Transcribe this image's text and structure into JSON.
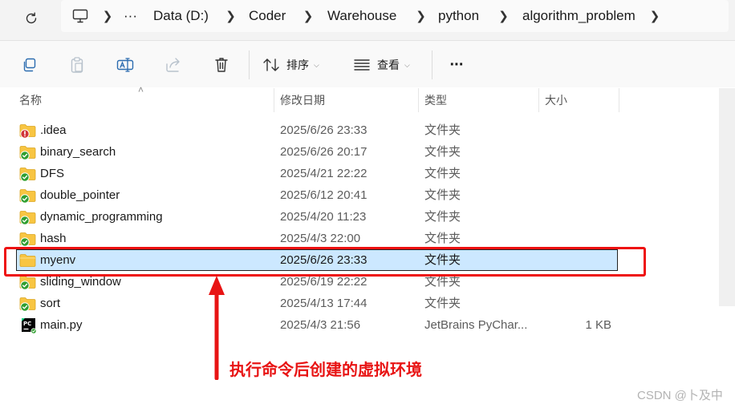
{
  "address_bar": {
    "breadcrumbs": [
      "Data (D:)",
      "Coder",
      "Warehouse",
      "python",
      "algorithm_problem"
    ],
    "more_label": "···",
    "icons": [
      "refresh-icon",
      "monitor-icon",
      "chevron-right-icon"
    ]
  },
  "toolbar": {
    "sort_label": "排序",
    "view_label": "查看",
    "more_label": "···",
    "icons": [
      "copy-icon",
      "paste-icon",
      "rename-icon",
      "share-icon",
      "delete-icon",
      "sort-icon",
      "view-icon"
    ]
  },
  "columns": {
    "name": "名称",
    "modified": "修改日期",
    "type": "类型",
    "size": "大小"
  },
  "files": [
    {
      "name": ".idea",
      "modified": "2025/6/26 23:33",
      "type": "文件夹",
      "size": "",
      "icon": "folder-warning-icon",
      "selected": false
    },
    {
      "name": "binary_search",
      "modified": "2025/6/26 20:17",
      "type": "文件夹",
      "size": "",
      "icon": "folder-synced-icon",
      "selected": false
    },
    {
      "name": "DFS",
      "modified": "2025/4/21 22:22",
      "type": "文件夹",
      "size": "",
      "icon": "folder-synced-icon",
      "selected": false
    },
    {
      "name": "double_pointer",
      "modified": "2025/6/12 20:41",
      "type": "文件夹",
      "size": "",
      "icon": "folder-synced-icon",
      "selected": false
    },
    {
      "name": "dynamic_programming",
      "modified": "2025/4/20 11:23",
      "type": "文件夹",
      "size": "",
      "icon": "folder-synced-icon",
      "selected": false
    },
    {
      "name": "hash",
      "modified": "2025/4/3 22:00",
      "type": "文件夹",
      "size": "",
      "icon": "folder-synced-icon",
      "selected": false
    },
    {
      "name": "myenv",
      "modified": "2025/6/26 23:33",
      "type": "文件夹",
      "size": "",
      "icon": "folder-icon",
      "selected": true
    },
    {
      "name": "sliding_window",
      "modified": "2025/6/19 22:22",
      "type": "文件夹",
      "size": "",
      "icon": "folder-synced-icon",
      "selected": false
    },
    {
      "name": "sort",
      "modified": "2025/4/13 17:44",
      "type": "文件夹",
      "size": "",
      "icon": "folder-synced-icon",
      "selected": false
    },
    {
      "name": "main.py",
      "modified": "2025/4/3 21:56",
      "type": "JetBrains PyChar...",
      "size": "1 KB",
      "icon": "pycharm-file-icon",
      "selected": false
    }
  ],
  "annotation": {
    "caption": "执行命令后创建的虚拟环境",
    "color": "#e81414"
  },
  "watermark": "CSDN @卜及中",
  "colors": {
    "selection": "#cce8ff",
    "folder": "#f8c542",
    "sync_ok": "#2f9e2f",
    "warning": "#d13438"
  }
}
